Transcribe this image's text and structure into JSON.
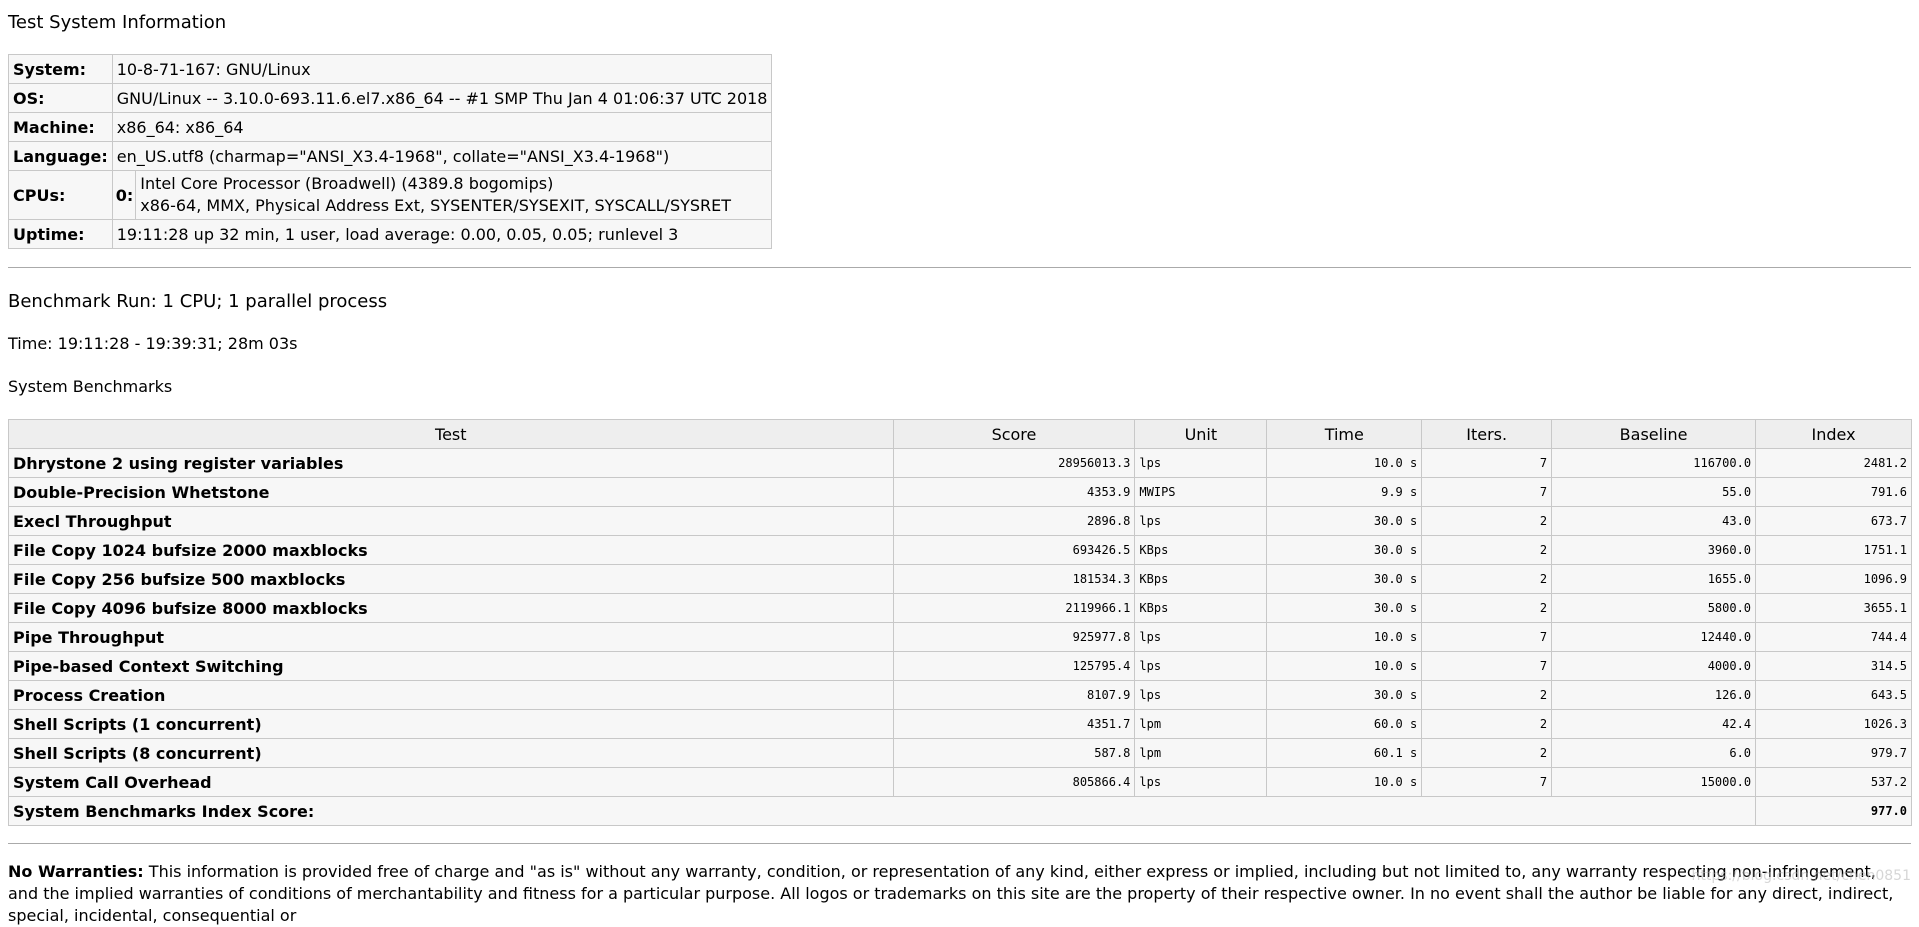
{
  "system_section": {
    "title": "Test System Information",
    "rows": [
      {
        "label": "System:",
        "value": "10-8-71-167: GNU/Linux"
      },
      {
        "label": "OS:",
        "value": "GNU/Linux -- 3.10.0-693.11.6.el7.x86_64 -- #1 SMP Thu Jan 4 01:06:37 UTC 2018"
      },
      {
        "label": "Machine:",
        "value": "x86_64: x86_64"
      },
      {
        "label": "Language:",
        "value": "en_US.utf8 (charmap=\"ANSI_X3.4-1968\", collate=\"ANSI_X3.4-1968\")"
      }
    ],
    "cpus": {
      "label": "CPUs:",
      "index": "0:",
      "line1": "Intel Core Processor (Broadwell) (4389.8 bogomips)",
      "line2": "x86-64, MMX, Physical Address Ext, SYSENTER/SYSEXIT, SYSCALL/SYSRET"
    },
    "uptime": {
      "label": "Uptime:",
      "value": "19:11:28 up 32 min, 1 user, load average: 0.00, 0.05, 0.05; runlevel 3"
    }
  },
  "run": {
    "title": "Benchmark Run: 1 CPU; 1 parallel process",
    "time": "Time: 19:11:28 - 19:39:31; 28m 03s",
    "benchmarks_title": "System Benchmarks"
  },
  "bench_table": {
    "headers": [
      "Test",
      "Score",
      "Unit",
      "Time",
      "Iters.",
      "Baseline",
      "Index"
    ],
    "rows": [
      {
        "test": "Dhrystone 2 using register variables",
        "score": "28956013.3",
        "unit": "lps",
        "time": "10.0 s",
        "iters": "7",
        "baseline": "116700.0",
        "index": "2481.2"
      },
      {
        "test": "Double-Precision Whetstone",
        "score": "4353.9",
        "unit": "MWIPS",
        "time": "9.9 s",
        "iters": "7",
        "baseline": "55.0",
        "index": "791.6"
      },
      {
        "test": "Execl Throughput",
        "score": "2896.8",
        "unit": "lps",
        "time": "30.0 s",
        "iters": "2",
        "baseline": "43.0",
        "index": "673.7"
      },
      {
        "test": "File Copy 1024 bufsize 2000 maxblocks",
        "score": "693426.5",
        "unit": "KBps",
        "time": "30.0 s",
        "iters": "2",
        "baseline": "3960.0",
        "index": "1751.1"
      },
      {
        "test": "File Copy 256 bufsize 500 maxblocks",
        "score": "181534.3",
        "unit": "KBps",
        "time": "30.0 s",
        "iters": "2",
        "baseline": "1655.0",
        "index": "1096.9"
      },
      {
        "test": "File Copy 4096 bufsize 8000 maxblocks",
        "score": "2119966.1",
        "unit": "KBps",
        "time": "30.0 s",
        "iters": "2",
        "baseline": "5800.0",
        "index": "3655.1"
      },
      {
        "test": "Pipe Throughput",
        "score": "925977.8",
        "unit": "lps",
        "time": "10.0 s",
        "iters": "7",
        "baseline": "12440.0",
        "index": "744.4"
      },
      {
        "test": "Pipe-based Context Switching",
        "score": "125795.4",
        "unit": "lps",
        "time": "10.0 s",
        "iters": "7",
        "baseline": "4000.0",
        "index": "314.5"
      },
      {
        "test": "Process Creation",
        "score": "8107.9",
        "unit": "lps",
        "time": "30.0 s",
        "iters": "2",
        "baseline": "126.0",
        "index": "643.5"
      },
      {
        "test": "Shell Scripts (1 concurrent)",
        "score": "4351.7",
        "unit": "lpm",
        "time": "60.0 s",
        "iters": "2",
        "baseline": "42.4",
        "index": "1026.3"
      },
      {
        "test": "Shell Scripts (8 concurrent)",
        "score": "587.8",
        "unit": "lpm",
        "time": "60.1 s",
        "iters": "2",
        "baseline": "6.0",
        "index": "979.7"
      },
      {
        "test": "System Call Overhead",
        "score": "805866.4",
        "unit": "lps",
        "time": "10.0 s",
        "iters": "7",
        "baseline": "15000.0",
        "index": "537.2"
      }
    ],
    "total_label": "System Benchmarks Index Score:",
    "total_value": "977.0"
  },
  "footer": {
    "bold": "No Warranties:",
    "text": " This information is provided free of charge and \"as is\" without any warranty, condition, or representation of any kind, either express or implied, including but not limited to, any warranty respecting non-infringement, and the implied warranties of conditions of merchantability and fitness for a particular purpose. All logos or trademarks on this site are the property of their respective owner. In no event shall the author be liable for any direct, indirect, special, incidental, consequential or"
  },
  "watermark": "https://blog.csdn.net/chen0851"
}
